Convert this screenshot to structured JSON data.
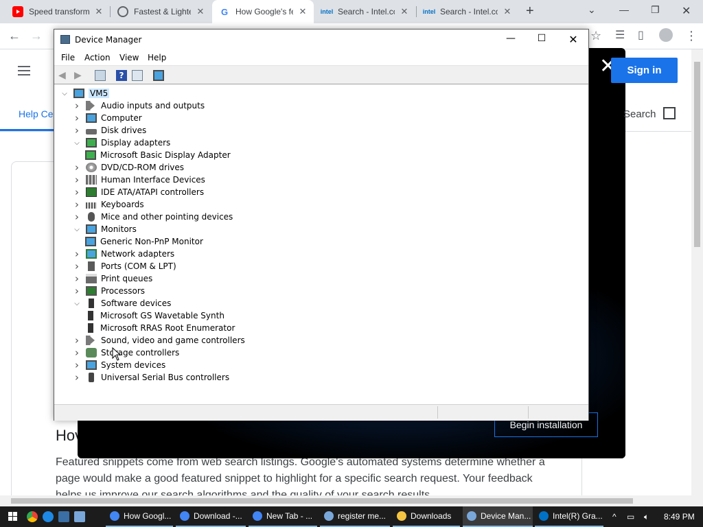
{
  "browser": {
    "tabs": [
      {
        "title": "Speed transformation",
        "favicon": "youtube-icon",
        "color": "#ff0000"
      },
      {
        "title": "Fastest & Lightest",
        "favicon": "globe-icon",
        "color": "#5f6368"
      },
      {
        "title": "How Google's featured",
        "favicon": "google-icon",
        "color": "#4285f4"
      },
      {
        "title": "Search - Intel.com",
        "favicon": "intel-icon",
        "color": "#0071c5"
      },
      {
        "title": "Search - Intel.com",
        "favicon": "intel-icon",
        "color": "#0071c5"
      }
    ],
    "active_tab_index": 2
  },
  "page": {
    "help_tab": "Help Ce",
    "signin": "Sign in",
    "search_link": "Search",
    "heading": "Hov",
    "paragraph": "Featured snippets come from web search listings. Google's automated systems determine whether a page would make a good featured snippet to highlight for a specific search request. Your feedback helps us improve our search algorithms and the quality of your search results."
  },
  "overlay": {
    "begin_button": "Begin installation"
  },
  "device_manager": {
    "title": "Device Manager",
    "menus": [
      "File",
      "Action",
      "View",
      "Help"
    ],
    "root": "VM5",
    "tree": [
      {
        "label": "Audio inputs and outputs",
        "icon": "speaker-icon",
        "expanded": false,
        "level": 1
      },
      {
        "label": "Computer",
        "icon": "monitor-icon",
        "expanded": false,
        "level": 1
      },
      {
        "label": "Disk drives",
        "icon": "disk-icon",
        "expanded": false,
        "level": 1
      },
      {
        "label": "Display adapters",
        "icon": "display-adapter-icon",
        "expanded": true,
        "level": 1
      },
      {
        "label": "Microsoft Basic Display Adapter",
        "icon": "display-adapter-icon",
        "level": 2
      },
      {
        "label": "DVD/CD-ROM drives",
        "icon": "dvd-icon",
        "expanded": false,
        "level": 1
      },
      {
        "label": "Human Interface Devices",
        "icon": "hid-icon",
        "expanded": false,
        "level": 1
      },
      {
        "label": "IDE ATA/ATAPI controllers",
        "icon": "ide-icon",
        "expanded": false,
        "level": 1
      },
      {
        "label": "Keyboards",
        "icon": "keyboard-icon",
        "expanded": false,
        "level": 1
      },
      {
        "label": "Mice and other pointing devices",
        "icon": "mouse-icon",
        "expanded": false,
        "level": 1
      },
      {
        "label": "Monitors",
        "icon": "monitor-icon",
        "expanded": true,
        "level": 1
      },
      {
        "label": "Generic Non-PnP Monitor",
        "icon": "monitor-icon",
        "level": 2
      },
      {
        "label": "Network adapters",
        "icon": "network-icon",
        "expanded": false,
        "level": 1
      },
      {
        "label": "Ports (COM & LPT)",
        "icon": "port-icon",
        "expanded": false,
        "level": 1
      },
      {
        "label": "Print queues",
        "icon": "printer-icon",
        "expanded": false,
        "level": 1
      },
      {
        "label": "Processors",
        "icon": "processor-icon",
        "expanded": false,
        "level": 1
      },
      {
        "label": "Software devices",
        "icon": "software-device-icon",
        "expanded": true,
        "level": 1
      },
      {
        "label": "Microsoft GS Wavetable Synth",
        "icon": "software-device-icon",
        "level": 2
      },
      {
        "label": "Microsoft RRAS Root Enumerator",
        "icon": "software-device-icon",
        "level": 2
      },
      {
        "label": "Sound, video and game controllers",
        "icon": "speaker-icon",
        "expanded": false,
        "level": 1
      },
      {
        "label": "Storage controllers",
        "icon": "storage-icon",
        "expanded": false,
        "level": 1
      },
      {
        "label": "System devices",
        "icon": "system-icon",
        "expanded": false,
        "level": 1
      },
      {
        "label": "Universal Serial Bus controllers",
        "icon": "usb-icon",
        "expanded": false,
        "level": 1
      }
    ]
  },
  "taskbar": {
    "tasks": [
      {
        "label": "How Googl...",
        "icon": "chrome-icon",
        "color": "#4285f4"
      },
      {
        "label": "Download -...",
        "icon": "chrome-icon",
        "color": "#4285f4"
      },
      {
        "label": "New Tab - ...",
        "icon": "chrome-icon",
        "color": "#4285f4"
      },
      {
        "label": "register me...",
        "icon": "notepad-icon",
        "color": "#7aa7d9"
      },
      {
        "label": "Downloads",
        "icon": "folder-icon",
        "color": "#f4c542"
      },
      {
        "label": "Device Man...",
        "icon": "device-manager-icon",
        "color": "#7aa7d9"
      },
      {
        "label": "Intel(R) Gra...",
        "icon": "intel-icon",
        "color": "#0071c5"
      }
    ],
    "active_task_index": 5,
    "clock": "8:49 PM"
  }
}
